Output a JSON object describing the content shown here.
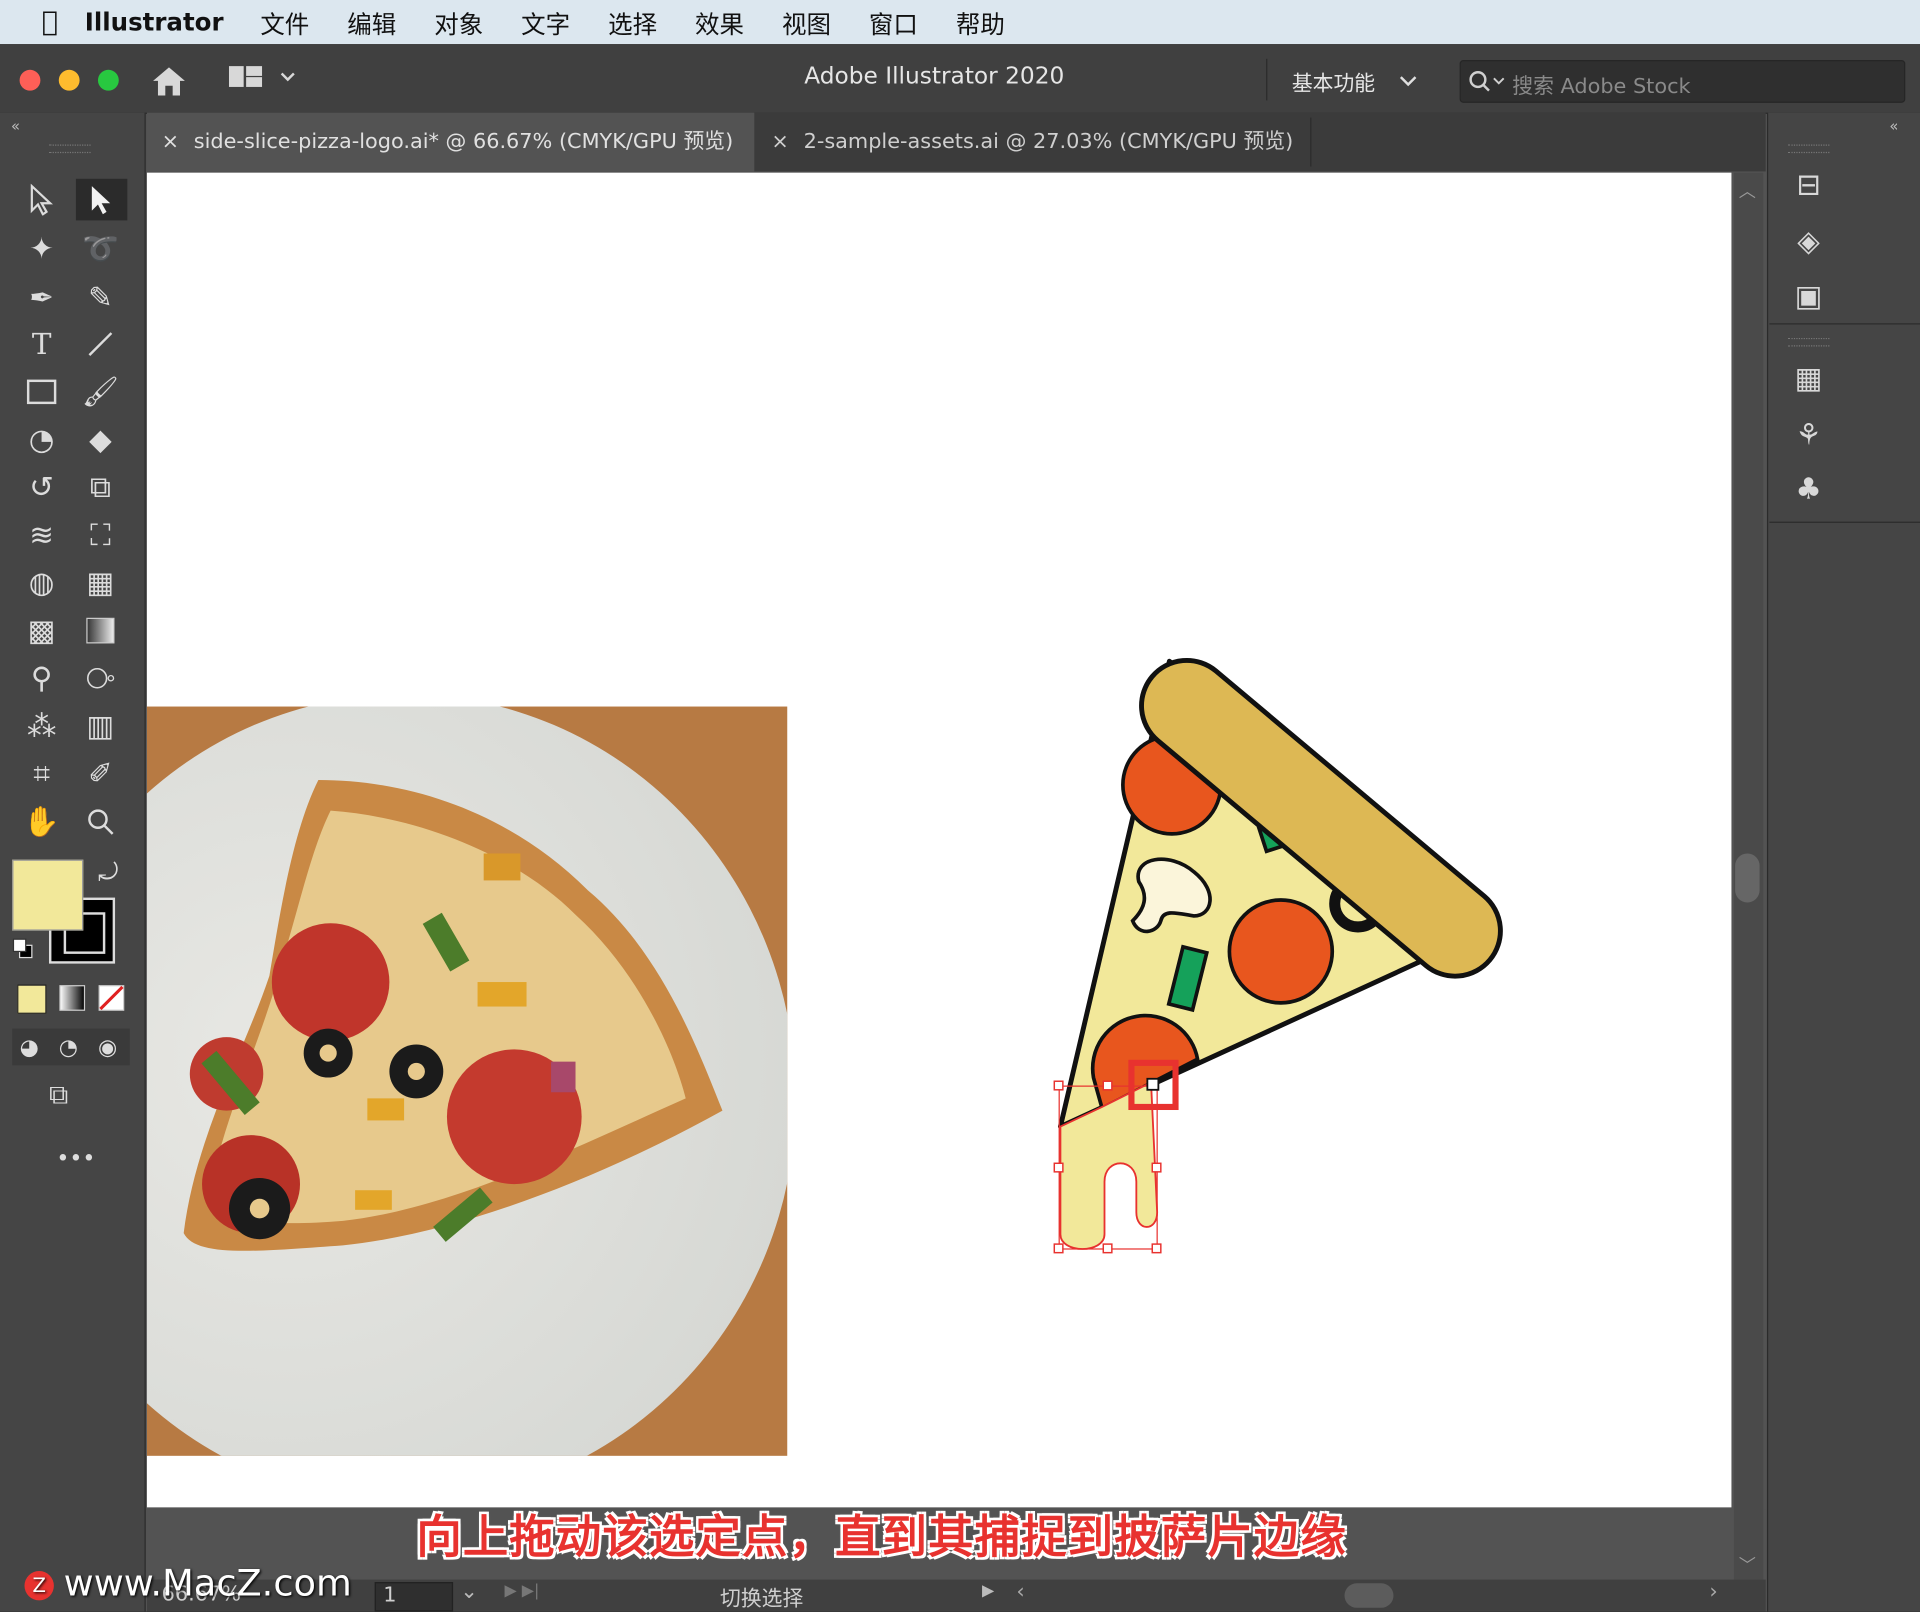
{
  "menubar": {
    "app_name": "Illustrator",
    "items": [
      "文件",
      "编辑",
      "对象",
      "文字",
      "选择",
      "效果",
      "视图",
      "窗口",
      "帮助"
    ]
  },
  "window": {
    "title": "Adobe Illustrator 2020",
    "workspace": "基本功能",
    "search_placeholder": "搜索 Adobe Stock"
  },
  "tabs": [
    {
      "label": "side-slice-pizza-logo.ai* @ 66.67% (CMYK/GPU 预览)",
      "close": "×"
    },
    {
      "label": "2-sample-assets.ai @ 27.03% (CMYK/GPU 预览)",
      "close": "×"
    }
  ],
  "toolbar": {
    "more_label": "•••",
    "fill_color": "#F2E89A",
    "stroke_color": "#000000"
  },
  "status": {
    "zoom": "66.67%",
    "artboard_number": "1",
    "mode": "切换选择"
  },
  "caption": "向上拖动该选定点，直到其捕捉到披萨片边缘",
  "watermark": "www.MacZ.com",
  "colors": {
    "crust": "#DDB854",
    "cheese": "#F2E89A",
    "pepperoni": "#E8561E",
    "green_pepper": "#15A15A",
    "selection": "#E8322F"
  }
}
